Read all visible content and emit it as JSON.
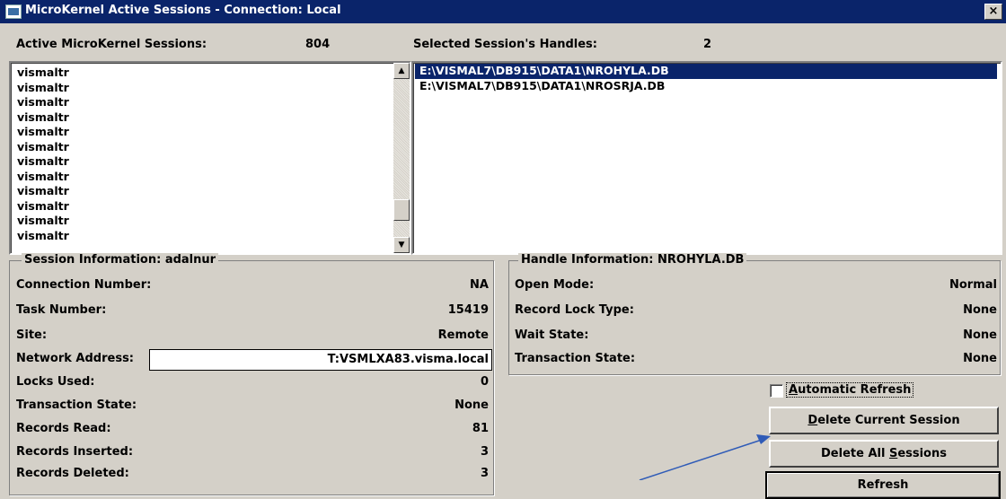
{
  "window": {
    "title": "MicroKernel Active Sessions  -  Connection: Local",
    "close_label": "×"
  },
  "sessions": {
    "header_label": "Active MicroKernel Sessions:",
    "count": "804",
    "items": [
      "vismaltr",
      "vismaltr",
      "vismaltr",
      "vismaltr",
      "vismaltr",
      "vismaltr",
      "vismaltr",
      "vismaltr",
      "vismaltr",
      "vismaltr",
      "vismaltr",
      "vismaltr"
    ]
  },
  "handles": {
    "header_label": "Selected Session's Handles:",
    "count": "2",
    "items": [
      "E:\\VISMAL7\\DB915\\DATA1\\NROHYLA.DB",
      "E:\\VISMAL7\\DB915\\DATA1\\NROSRJA.DB"
    ],
    "selected_index": 0
  },
  "session_info": {
    "title": "Session Information: adalnur",
    "connection_number_label": "Connection Number:",
    "connection_number": "NA",
    "task_number_label": "Task Number:",
    "task_number": "15419",
    "site_label": "Site:",
    "site": "Remote",
    "network_address_label": "Network Address:",
    "network_address": "T:VSMLXA83.visma.local",
    "locks_used_label": "Locks Used:",
    "locks_used": "0",
    "transaction_state_label": "Transaction State:",
    "transaction_state": "None",
    "records_read_label": "Records Read:",
    "records_read": "81",
    "records_inserted_label": "Records Inserted:",
    "records_inserted": "3",
    "records_deleted_label": "Records Deleted:",
    "records_deleted": "3"
  },
  "handle_info": {
    "title": "Handle Information: NROHYLA.DB",
    "open_mode_label": "Open Mode:",
    "open_mode": "Normal",
    "record_lock_type_label": "Record Lock Type:",
    "record_lock_type": "None",
    "wait_state_label": "Wait State:",
    "wait_state": "None",
    "transaction_state_label": "Transaction State:",
    "transaction_state": "None"
  },
  "controls": {
    "auto_refresh_prefix": "A",
    "auto_refresh_rest": "utomatic Refresh",
    "auto_refresh_checked": false,
    "delete_current_prefix": "D",
    "delete_current_rest": "elete Current Session",
    "delete_all_prefix": "Delete All ",
    "delete_all_s": "S",
    "delete_all_rest": "essions",
    "refresh_label": "Refresh"
  },
  "colors": {
    "titlebar": "#0a246a",
    "selection": "#0a246a",
    "window_bg": "#d4d0c8",
    "arrow": "#2f5bb7"
  }
}
